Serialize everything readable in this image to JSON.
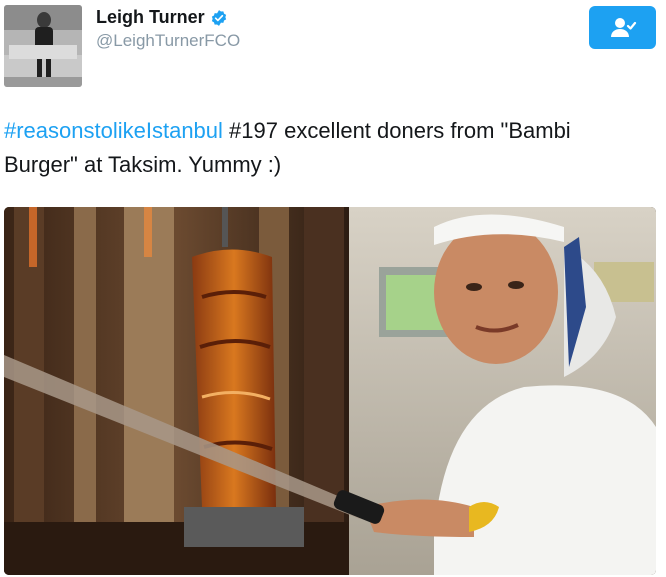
{
  "author": {
    "display_name": "Leigh Turner",
    "handle": "@LeighTurnerFCO",
    "verified_icon": "verified-badge-icon"
  },
  "follow_button": {
    "icon": "follow-user-icon",
    "color": "#1da1f2"
  },
  "tweet": {
    "hashtag": "#reasonstolikeIstanbul",
    "text": " #197 excellent doners from \"Bambi Burger\" at Taksim. Yummy :)"
  },
  "colors": {
    "accent": "#1da1f2",
    "text": "#14171a",
    "muted": "#8899a6"
  }
}
